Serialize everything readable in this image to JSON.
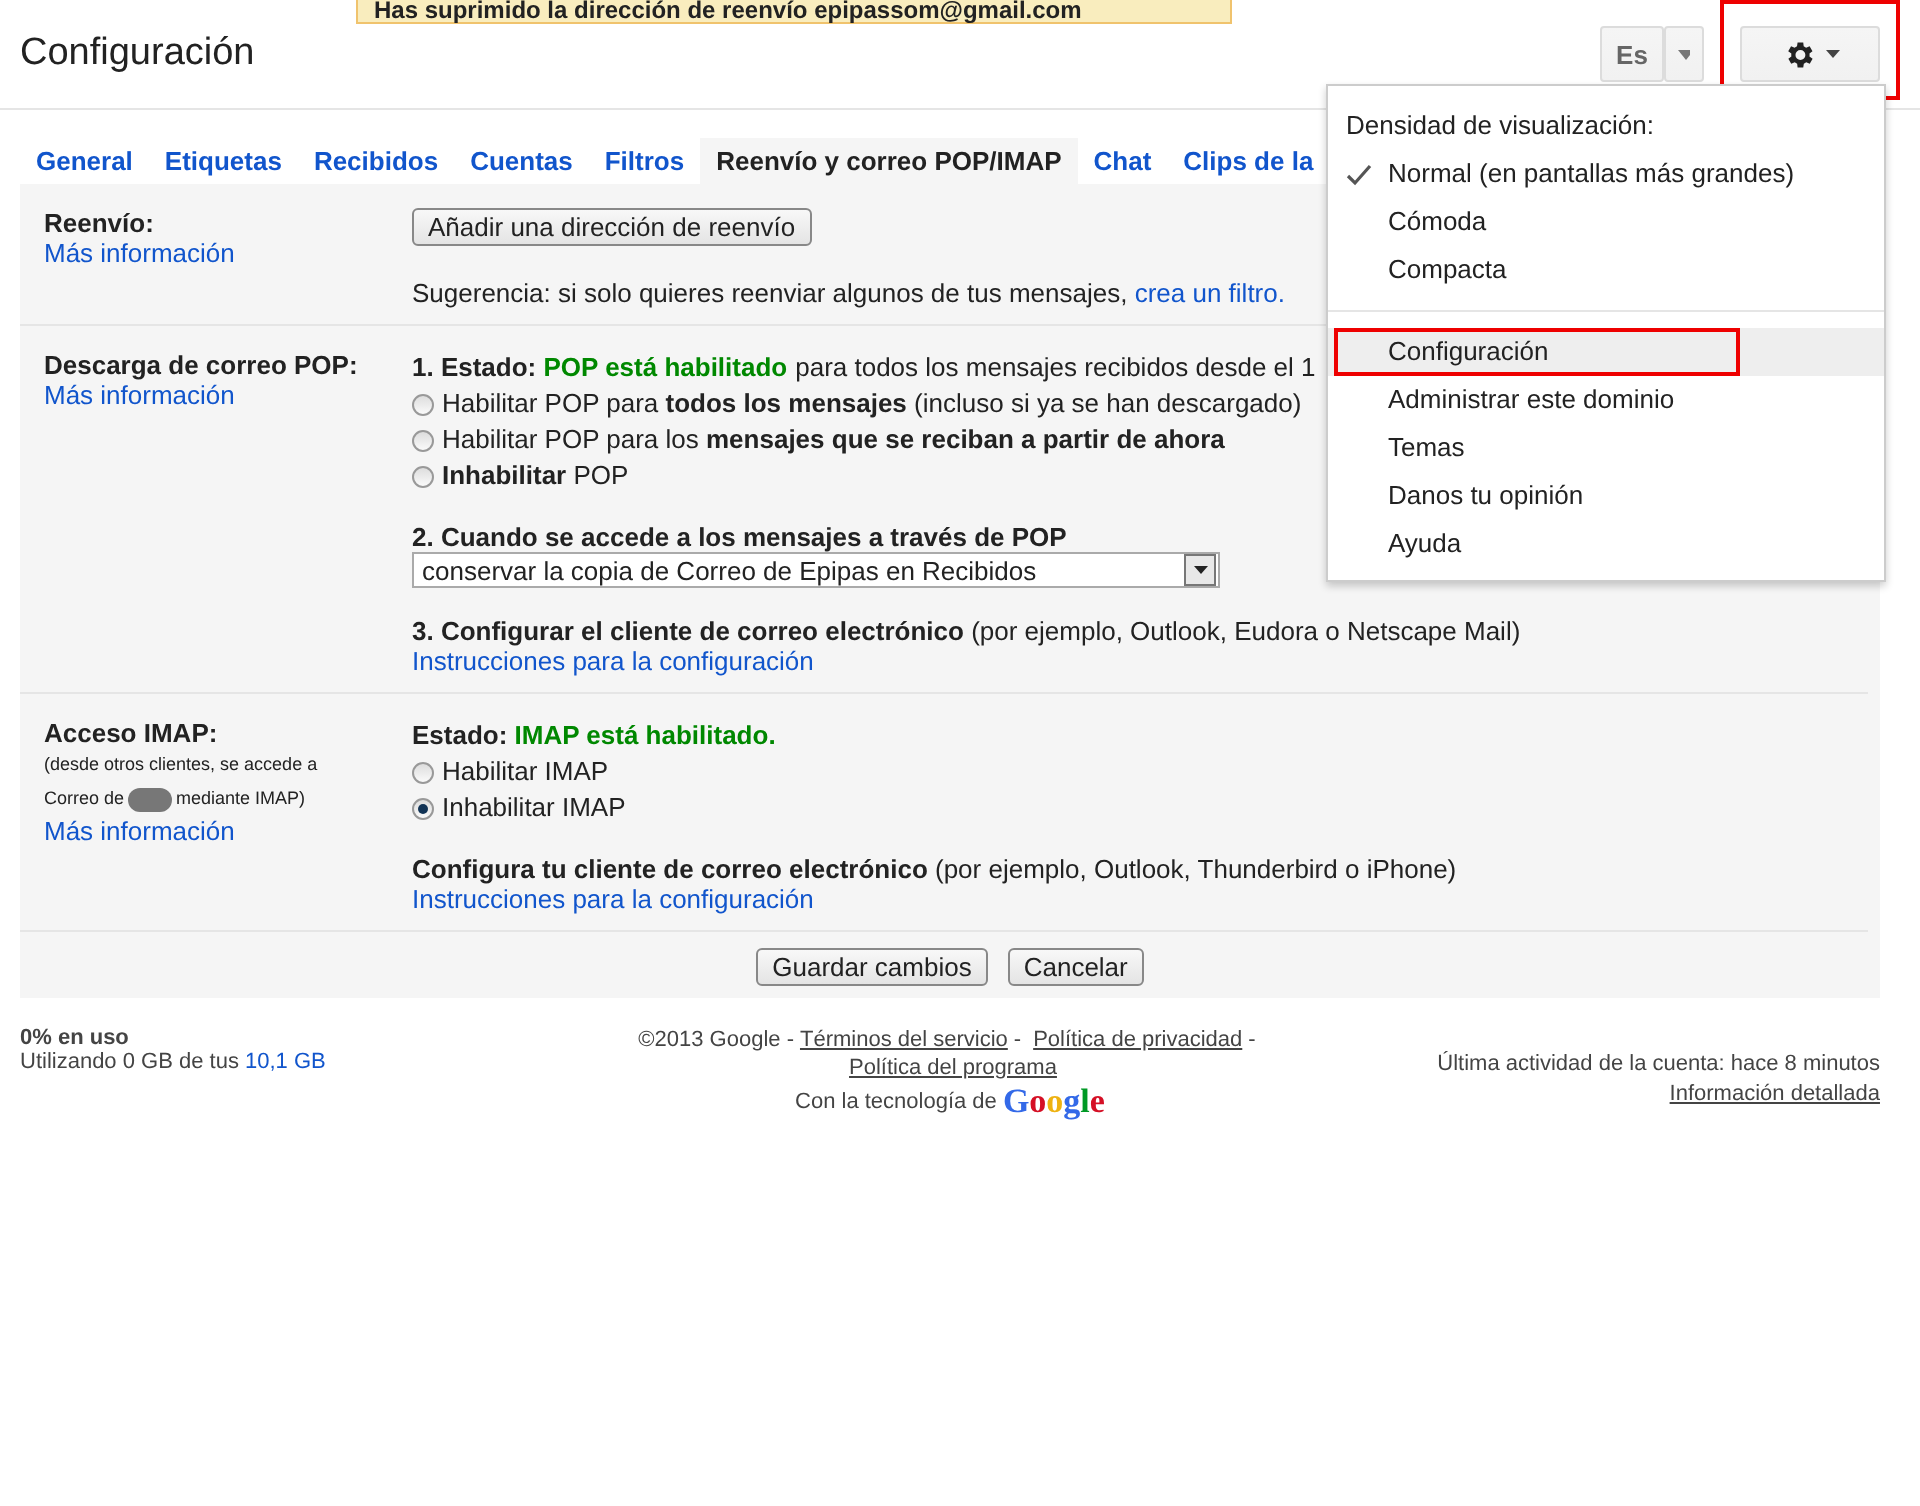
{
  "notification": "Has suprimido la dirección de reenvío epipassom@gmail.com",
  "title": "Configuración",
  "language_button": {
    "label": "Es"
  },
  "gear_button": {
    "highlighted": true
  },
  "tabs": [
    {
      "label": "General",
      "selected": false
    },
    {
      "label": "Etiquetas",
      "selected": false
    },
    {
      "label": "Recibidos",
      "selected": false
    },
    {
      "label": "Cuentas",
      "selected": false
    },
    {
      "label": "Filtros",
      "selected": false
    },
    {
      "label": "Reenvío y correo POP/IMAP",
      "selected": true
    },
    {
      "label": "Chat",
      "selected": false
    },
    {
      "label": "Clips de la",
      "selected": false
    }
  ],
  "sections": [
    {
      "kind": "forwarding",
      "title": "Reenvío:",
      "link": "Más información",
      "button": "Añadir una dirección de reenvío",
      "hint": "Sugerencia: si solo quieres reenviar algunos de tus mensajes,",
      "hint_link": "crea un filtro."
    },
    {
      "kind": "pop",
      "title": "Descarga de correo POP:",
      "link": "Más información",
      "status_label": "1. Estado:",
      "status_value": "POP está habilitado",
      "status_rest": "para todos los mensajes recibidos desde el 1",
      "options": [
        {
          "text": "Habilitar POP para **todos los mensajes** (incluso si ya se han descargado)",
          "selected": false
        },
        {
          "text": "Habilitar POP para los **mensajes que se reciban a partir de ahora**",
          "selected": false
        },
        {
          "text": "**Inhabilitar** POP",
          "selected": false
        }
      ],
      "step2": "2. Cuando se accede a los mensajes a través de POP",
      "dropdown": "conservar la copia de Correo de Epipas en Recibidos",
      "step3": "**3. Configurar el cliente de correo electrónico** (por ejemplo, Outlook, Eudora o Netscape Mail)",
      "step3_link": "Instrucciones para la configuración"
    },
    {
      "kind": "imap",
      "title": "Acceso IMAP:",
      "note_line": "(desde otros clientes, se accede a",
      "note_start": "Correo de",
      "note_end": "mediante IMAP)",
      "link": "Más información",
      "status_label": "Estado:",
      "status_value": "IMAP está habilitado.",
      "options": [
        {
          "text": "Habilitar IMAP",
          "selected": false
        },
        {
          "text": "Inhabilitar IMAP",
          "selected": true
        }
      ],
      "step3": "**Configura tu cliente de correo electrónico** (por ejemplo, Outlook, Thunderbird o iPhone)",
      "step3_link": "Instrucciones para la configuración"
    }
  ],
  "actions": [
    "Guardar cambios",
    "Cancelar"
  ],
  "footer": {
    "usage": "0% en uso",
    "usage_detail_start": "Utilizando 0 GB de tus",
    "usage_detail_value": "10,1 GB",
    "copyright": "©2013 Google -",
    "links": [
      {
        "label": "Términos del servicio",
        "sep": "-"
      },
      {
        "label": "Política de privacidad",
        "sep": "-"
      },
      {
        "label": "Política del programa"
      }
    ],
    "powered": "Con la tecnología de",
    "powered_logo": "Google",
    "activity": "Última actividad de la cuenta: hace 8 minutos",
    "details_link": "Información detallada"
  },
  "menu": {
    "heading": "Densidad de visualización:",
    "density": [
      {
        "label": "Normal (en pantallas más grandes)",
        "checked": true
      },
      {
        "label": "Cómoda",
        "checked": false
      },
      {
        "label": "Compacta",
        "checked": false
      }
    ],
    "items": [
      {
        "label": "Configuración",
        "selected": true,
        "highlighted": true
      },
      {
        "label": "Administrar este dominio",
        "selected": false,
        "highlighted": false
      },
      {
        "label": "Temas",
        "selected": false,
        "highlighted": false
      },
      {
        "label": "Danos tu opinión",
        "selected": false,
        "highlighted": false
      },
      {
        "label": "Ayuda",
        "selected": false,
        "highlighted": false
      }
    ]
  }
}
